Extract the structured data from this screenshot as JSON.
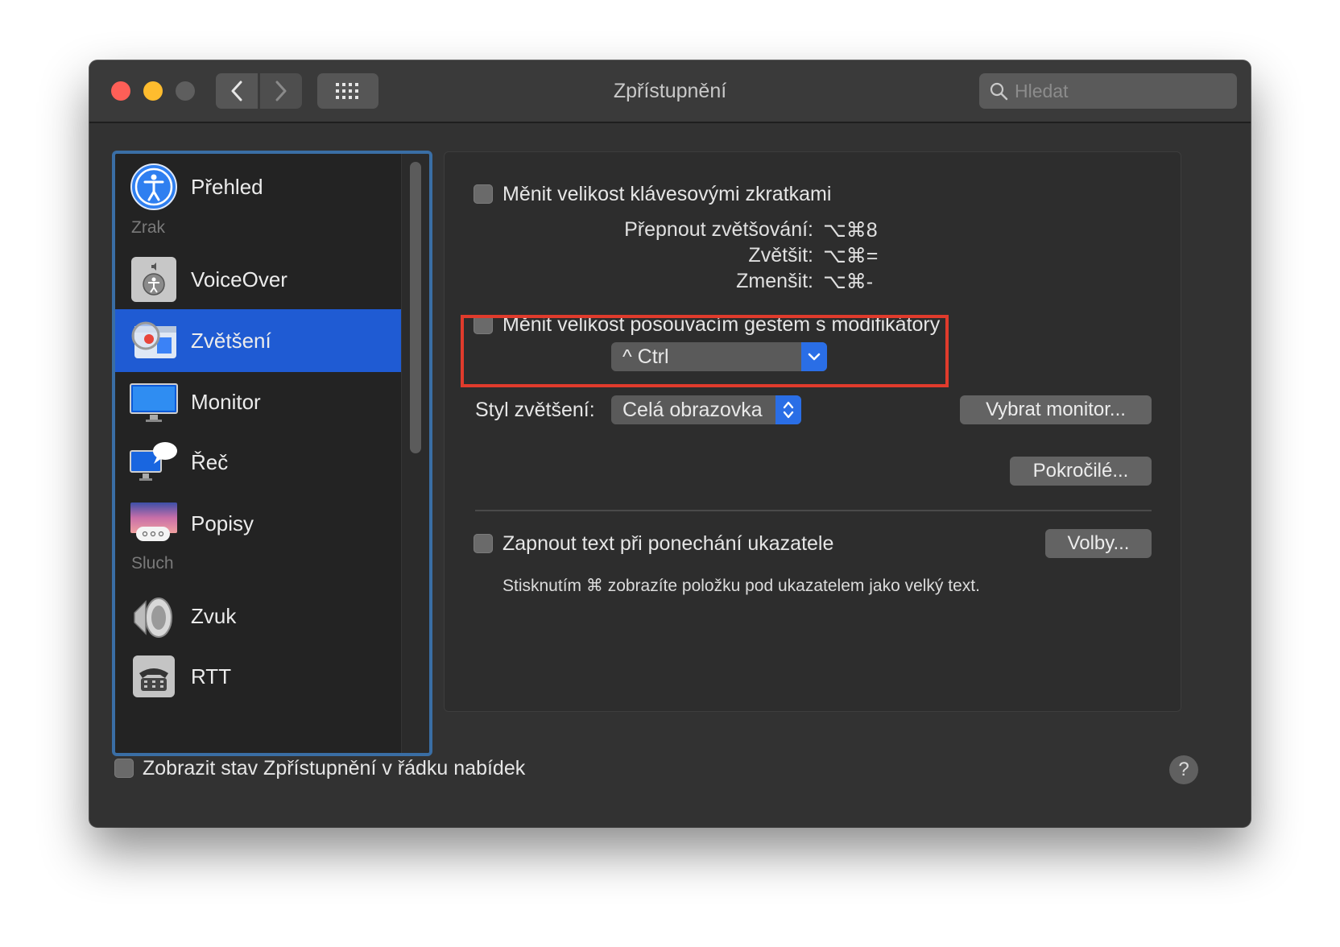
{
  "window": {
    "title": "Zpřístupnění",
    "search_placeholder": "Hledat"
  },
  "icons": {
    "back": "chevron-left-icon",
    "forward": "chevron-right-icon",
    "grid": "grid-icon",
    "search": "search-icon"
  },
  "sidebar": {
    "items": [
      {
        "label": "Přehled",
        "icon": "accessibility-icon"
      },
      {
        "label": "VoiceOver",
        "icon": "voiceover-icon"
      },
      {
        "label": "Zvětšení",
        "icon": "zoom-icon",
        "selected": true
      },
      {
        "label": "Monitor",
        "icon": "display-icon"
      },
      {
        "label": "Řeč",
        "icon": "speech-icon"
      },
      {
        "label": "Popisy",
        "icon": "captions-icon"
      },
      {
        "label": "Zvuk",
        "icon": "speaker-icon"
      },
      {
        "label": "RTT",
        "icon": "telephone-icon"
      }
    ],
    "sections": [
      "Zrak",
      "Sluch"
    ]
  },
  "zoom": {
    "keyboard_shortcuts_label": "Měnit velikost klávesovými zkratkami",
    "shortcuts": [
      {
        "label": "Přepnout zvětšování:",
        "keys": "⌥⌘8"
      },
      {
        "label": "Zvětšit:",
        "keys": "⌥⌘="
      },
      {
        "label": "Zmenšit:",
        "keys": "⌥⌘-"
      }
    ],
    "scroll_gesture_label": "Měnit velikost posouvacím gestem s modifikátory",
    "modifier_value": "^ Ctrl",
    "style_label": "Styl zvětšení:",
    "style_value": "Celá obrazovka",
    "choose_display_button": "Vybrat monitor...",
    "advanced_button": "Pokročilé...",
    "hover_text_label": "Zapnout text při ponechání ukazatele",
    "options_button": "Volby...",
    "hover_hint": "Stisknutím ⌘ zobrazíte položku pod ukazatelem jako velký text."
  },
  "footer": {
    "menu_bar_status_label": "Zobrazit stav Zpřístupnění v řádku nabídek",
    "help": "?"
  },
  "colors": {
    "selection": "#1f5bd3",
    "highlight_box": "#e03b2c",
    "accent_blue": "#2a6ee6"
  }
}
